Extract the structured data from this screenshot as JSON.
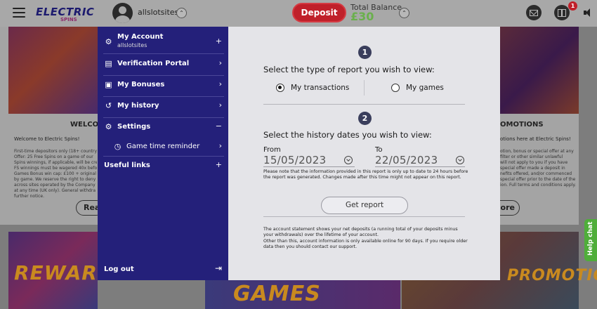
{
  "header": {
    "logo_text": "ELECTRIC",
    "logo_sub": "SPINS",
    "username": "allslotsites",
    "deposit_label": "Deposit",
    "balance_label": "Total Balance",
    "balance_value": "£30",
    "notification_count": "1"
  },
  "background": {
    "left_card": {
      "title": "WELCO",
      "welcome": "Welcome to Electric Spins!",
      "body": "First-time depositors only (18+ country\nOffer: 25 Free Spins on a game of our\nSpins winnings, if applicable, will be cre\nFS winnings must be wagered 40x befo\nGames Bonus win cap: £100 + original\nby game. We reserve the right to deny\nacross sites operated by the Company\nat any time (UK only). General withdra\nfurther notice.",
      "button": "Rea"
    },
    "right_card": {
      "title": "OMOTIONS",
      "welcome": "otions here at Electric Spins!",
      "body": "otion, bonus or special offer at any\nfilter or other similar unlawful\nwill not apply to you if you have\nspecial offer made a deposit in\nnefits offered, and/or commenced\nspecial offer prior to the date of the\nion. Full terms and conditions apply.",
      "button": "more"
    },
    "bottom_banners": [
      "REWARDS",
      "GAMES",
      "PROMOTION"
    ]
  },
  "menu": {
    "account_label": "My Account",
    "account_sub": "allslotsites",
    "items": [
      {
        "label": "Verification Portal"
      },
      {
        "label": "My Bonuses"
      },
      {
        "label": "My history"
      },
      {
        "label": "Settings"
      },
      {
        "label": "Game time reminder"
      },
      {
        "label": "Useful links"
      }
    ],
    "logout_label": "Log out"
  },
  "report": {
    "step1": "1",
    "step1_heading": "Select the type of report you wish to view:",
    "options": [
      {
        "label": "My transactions",
        "selected": true
      },
      {
        "label": "My games",
        "selected": false
      }
    ],
    "step2": "2",
    "step2_heading": "Select the history dates you wish to view:",
    "from_label": "From",
    "from_value": "15/05/2023",
    "to_label": "To",
    "to_value": "22/05/2023",
    "note": "Please note that the information provided in this report is only up to date to 24 hours before the report was generated. Changes made after this time might not appear on this report.",
    "get_report_label": "Get report",
    "footer_note_1": "The account statement shows your net deposits (a running total of your deposits minus your withdrawals) over the lifetime of your account.",
    "footer_note_2": "Other than this, account information is only available online for 90 days. If you require older data then you should contact our support."
  },
  "help_chat_label": "Help chat",
  "colors": {
    "menu_bg": "#24207a",
    "deposit": "#c0202a",
    "balance": "#6ab04c",
    "help_chat": "#4fae3a"
  }
}
